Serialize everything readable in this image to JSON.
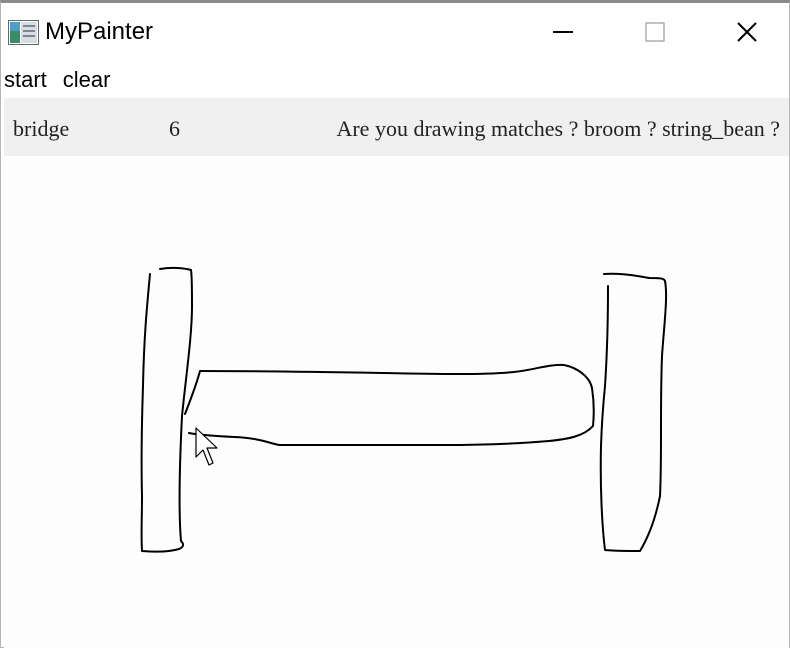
{
  "window": {
    "title": "MyPainter",
    "icon": "app-window-icon",
    "controls": [
      "minimize-icon",
      "maximize-icon",
      "close-icon"
    ]
  },
  "menu": {
    "items": [
      {
        "label": "start"
      },
      {
        "label": "clear"
      }
    ]
  },
  "info": {
    "word": "bridge",
    "count": "6",
    "guess": "Are you drawing matches ? broom ? string_bean ?"
  },
  "canvas": {
    "stroke_color": "#000000",
    "cursor": "arrow-cursor-icon"
  }
}
